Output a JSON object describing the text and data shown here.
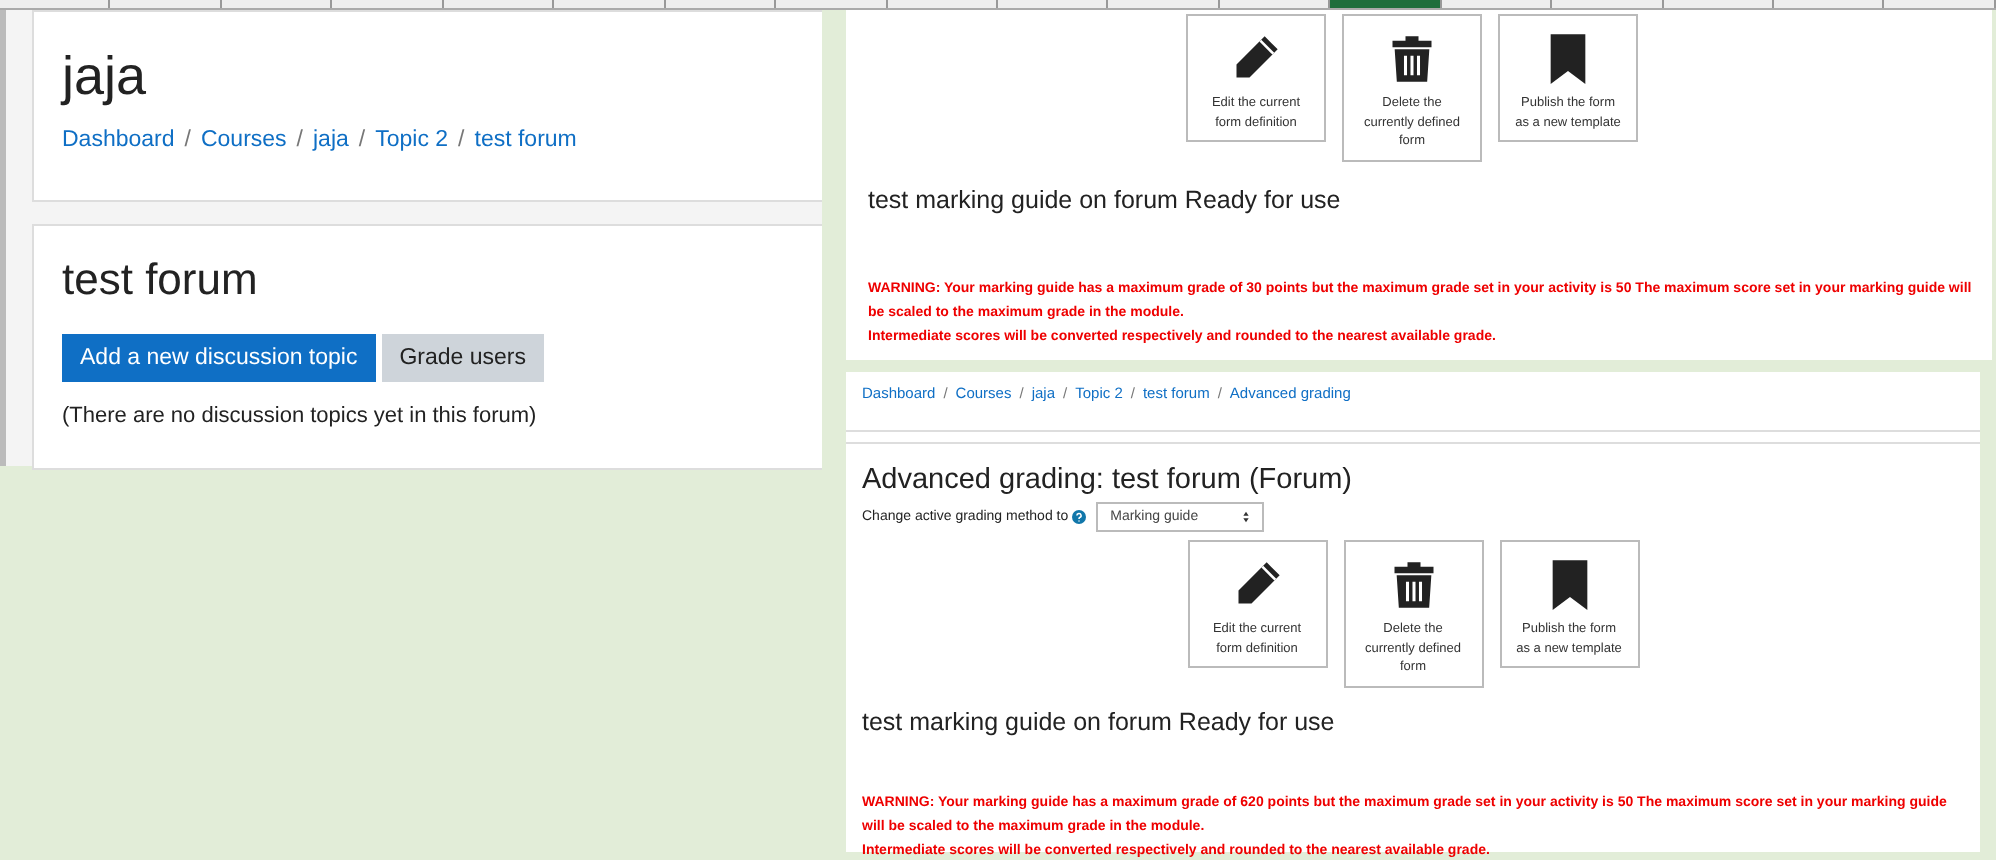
{
  "course_header": {
    "title": "jaja",
    "separator": "/",
    "breadcrumb": [
      "Dashboard",
      "Courses",
      "jaja",
      "Topic 2",
      "test forum"
    ]
  },
  "forum": {
    "title": "test forum",
    "buttons": [
      {
        "label": "Add a new discussion topic",
        "kind": "primary"
      },
      {
        "label": "Grade users",
        "kind": "secondary"
      }
    ],
    "message": "(There are no discussion topics yet in this forum)"
  },
  "grading_top": {
    "actions": [
      {
        "label": "Edit the current form definition",
        "kind": "edit"
      },
      {
        "label": "Delete the currently defined form",
        "kind": "delete"
      },
      {
        "label": "Publish the form as a new template",
        "kind": "publish"
      }
    ],
    "form_status": "test marking guide on forum Ready for use",
    "warning": [
      "WARNING: Your marking guide has a maximum grade of 30 points but the maximum grade set in your activity is 50 The maximum score set in your marking guide will be scaled to the maximum grade in the module.",
      "Intermediate scores will be converted respectively and rounded to the nearest available grade."
    ]
  },
  "grading_bottom": {
    "separator": "/",
    "breadcrumb": [
      "Dashboard",
      "Courses",
      "jaja",
      "Topic 2",
      "test forum",
      "Advanced grading"
    ],
    "title": "Advanced grading: test forum (Forum)",
    "method_label": "Change active grading method to",
    "method_value": "Marking guide",
    "actions": [
      {
        "label": "Edit the current form definition",
        "kind": "edit"
      },
      {
        "label": "Delete the currently defined form",
        "kind": "delete"
      },
      {
        "label": "Publish the form as a new template",
        "kind": "publish"
      }
    ],
    "form_status": "test marking guide on forum Ready for use",
    "warning": [
      "WARNING: Your marking guide has a maximum grade of 620 points but the maximum grade set in your activity is 50 The maximum score set in your marking guide will be scaled to the maximum grade in the module.",
      "Intermediate scores will be converted respectively and rounded to the nearest available grade."
    ]
  }
}
